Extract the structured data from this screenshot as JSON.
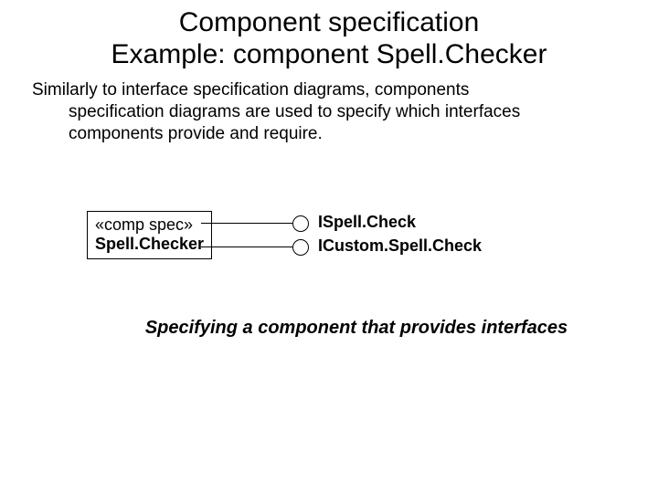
{
  "title_line1": "Component specification",
  "title_line2": "Example: component Spell.Checker",
  "body_first": "Similarly to interface specification diagrams, components",
  "body_rest1": "specification diagrams are used to specify which interfaces",
  "body_rest2": "components provide and require.",
  "component": {
    "stereotype": "«comp spec»",
    "name": "Spell.Checker"
  },
  "interfaces": [
    {
      "name": "ISpell.Check"
    },
    {
      "name": "ICustom.Spell.Check"
    }
  ],
  "caption": "Specifying a component that provides interfaces"
}
